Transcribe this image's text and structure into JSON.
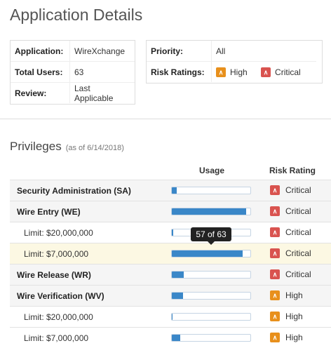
{
  "page": {
    "title": "Application Details"
  },
  "info_left": {
    "rows": [
      {
        "label": "Application:",
        "value": "WireXchange"
      },
      {
        "label": "Total Users:",
        "value": "63"
      },
      {
        "label": "Review:",
        "value": "Last Applicable"
      }
    ]
  },
  "info_right": {
    "priority_label": "Priority:",
    "priority_value": "All",
    "risk_label": "Risk Ratings:",
    "risk_high": "High",
    "risk_critical": "Critical"
  },
  "privileges": {
    "title": "Privileges",
    "note": "(as of 6/14/2018)",
    "col_usage": "Usage",
    "col_risk": "Risk Rating",
    "tooltip": "57 of 63",
    "rows": [
      {
        "name": "Security Administration (SA)",
        "limit": false,
        "usage": 0.06,
        "risk": "Critical"
      },
      {
        "name": "Wire Entry (WE)",
        "limit": false,
        "usage": 0.95,
        "risk": "Critical"
      },
      {
        "name": "Limit: $20,000,000",
        "limit": true,
        "usage": 0.02,
        "risk": "Critical"
      },
      {
        "name": "Limit: $7,000,000",
        "limit": true,
        "usage": 0.905,
        "risk": "Critical"
      },
      {
        "name": "Wire Release (WR)",
        "limit": false,
        "usage": 0.15,
        "risk": "Critical"
      },
      {
        "name": "Wire Verification (WV)",
        "limit": false,
        "usage": 0.14,
        "risk": "High"
      },
      {
        "name": "Limit: $20,000,000",
        "limit": true,
        "usage": 0.01,
        "risk": "High"
      },
      {
        "name": "Limit: $7,000,000",
        "limit": true,
        "usage": 0.11,
        "risk": "High"
      }
    ]
  },
  "colors": {
    "high": "#e8901c",
    "critical": "#d9534f",
    "bar": "#3a87c8",
    "highlight": "#fcf8e3"
  },
  "icons": {
    "high": "chevron-up-icon",
    "critical": "double-chevron-up-icon"
  }
}
